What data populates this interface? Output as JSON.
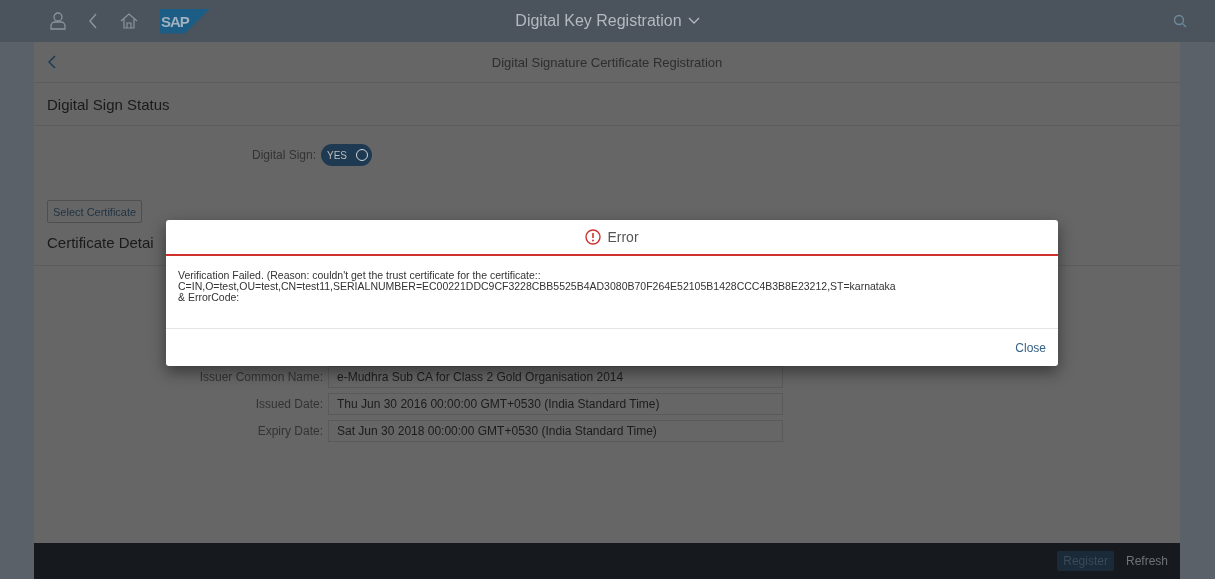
{
  "shell": {
    "logo": "SAP",
    "title": "Digital Key Registration"
  },
  "page": {
    "title": "Digital Signature Certificate Registration"
  },
  "status_section": {
    "title": "Digital Sign Status",
    "toggle_label": "Digital Sign:",
    "toggle": {
      "text": "YES",
      "on": true
    },
    "select_button": "Select Certificate"
  },
  "details_section": {
    "title": "Certificate Detai",
    "fields": [
      {
        "label": "Issuer Common Name:",
        "value": "e-Mudhra Sub CA for Class 2 Gold Organisation 2014"
      },
      {
        "label": "Issued Date:",
        "value": "Thu Jun 30 2016 00:00:00 GMT+0530 (India Standard Time)"
      },
      {
        "label": "Expiry Date:",
        "value": "Sat Jun 30 2018 00:00:00 GMT+0530 (India Standard Time)"
      }
    ]
  },
  "footer": {
    "buttons": [
      {
        "label": "Register",
        "disabled": true
      },
      {
        "label": "Refresh",
        "disabled": false
      }
    ]
  },
  "dialog": {
    "title": "Error",
    "message_lines": [
      "Verification Failed. (Reason: couldn't get the trust certificate for the certificate::",
      "C=IN,O=test,OU=test,CN=test11,SERIALNUMBER=EC00221DDC9CF3228CBB5525B4AD3080B70F264E52105B1428CCC4B3B8E23212,ST=karnataka",
      "& ErrorCode:"
    ],
    "close": "Close"
  }
}
